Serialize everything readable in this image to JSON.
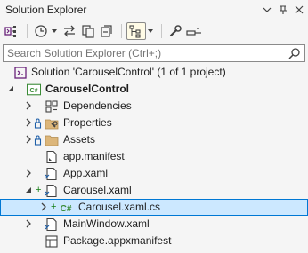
{
  "window": {
    "title": "Solution Explorer"
  },
  "search": {
    "placeholder": "Search Solution Explorer (Ctrl+;)"
  },
  "tree": {
    "solution": "Solution 'CarouselControl' (1 of 1 project)",
    "project": "CarouselControl",
    "dependencies": "Dependencies",
    "properties": "Properties",
    "assets": "Assets",
    "app_manifest": "app.manifest",
    "app_xaml": "App.xaml",
    "carousel_xaml": "Carousel.xaml",
    "carousel_xaml_cs": "Carousel.xaml.cs",
    "mainwindow_xaml": "MainWindow.xaml",
    "package_manifest": "Package.appxmanifest"
  },
  "colors": {
    "selection_bg": "#cce8ff",
    "selection_border": "#0078d4",
    "add_mark": "#107c10",
    "csharp": "#388a34"
  }
}
